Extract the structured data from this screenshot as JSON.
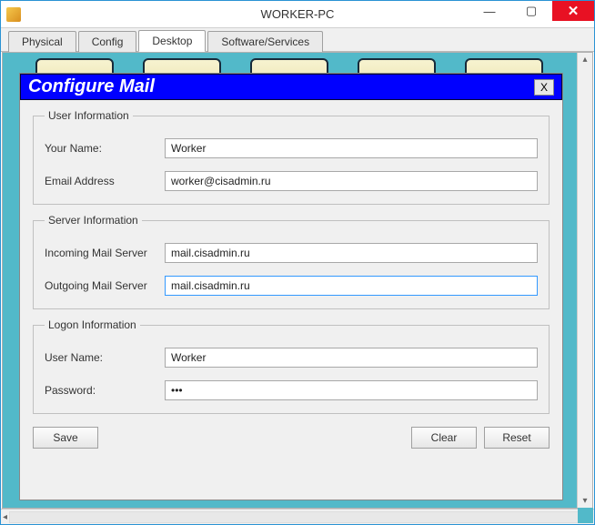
{
  "window": {
    "title": "WORKER-PC",
    "controls": {
      "min": "—",
      "max": "▢",
      "close": "✕"
    }
  },
  "tabs": {
    "physical": "Physical",
    "config": "Config",
    "desktop": "Desktop",
    "software": "Software/Services"
  },
  "dialog": {
    "title": "Configure Mail",
    "close_label": "X",
    "groups": {
      "user": {
        "legend": "User Information",
        "name_label": "Your Name:",
        "name_value": "Worker",
        "email_label": "Email Address",
        "email_value": "worker@cisadmin.ru"
      },
      "server": {
        "legend": "Server Information",
        "incoming_label": "Incoming Mail Server",
        "incoming_value": "mail.cisadmin.ru",
        "outgoing_label": "Outgoing Mail Server",
        "outgoing_value": "mail.cisadmin.ru"
      },
      "logon": {
        "legend": "Logon Information",
        "user_label": "User Name:",
        "user_value": "Worker",
        "password_label": "Password:",
        "password_value": "•••"
      }
    },
    "buttons": {
      "save": "Save",
      "clear": "Clear",
      "reset": "Reset"
    }
  },
  "scroll": {
    "up": "▴",
    "down": "▾",
    "left": "◂",
    "right": "▸"
  }
}
